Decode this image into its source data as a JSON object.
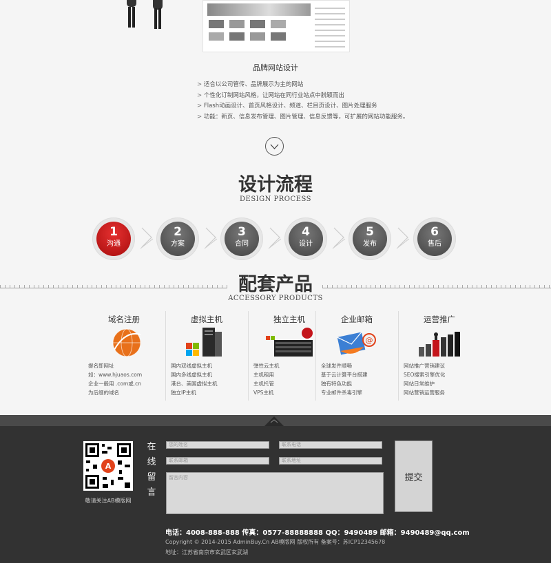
{
  "showcase": {
    "title": "品牌网站设计",
    "features": [
      "适合以公司管传、品牌展示为主的网站",
      "个性化订制网站风格，让网站在同行业站点中脱颖而出",
      "Flash动画设计、首页风格设计、频道、栏目页设计、图片处理服务",
      "功能：新页、信息发布管理、图片管理、信息反馈等，可扩展的网站功能服务。"
    ]
  },
  "process": {
    "title": "设计流程",
    "subtitle": "DESIGN PROCESS",
    "steps": [
      {
        "num": "1",
        "label": "沟通"
      },
      {
        "num": "2",
        "label": "方案"
      },
      {
        "num": "3",
        "label": "合同"
      },
      {
        "num": "4",
        "label": "设计"
      },
      {
        "num": "5",
        "label": "发布"
      },
      {
        "num": "6",
        "label": "售后"
      }
    ]
  },
  "products": {
    "title": "配套产品",
    "subtitle": "ACCESSORY PRODUCTS",
    "items": [
      {
        "title": "域名注册",
        "lines": [
          "提名即网址",
          "如：www.hjuaos.com",
          "企业一般用 .com或.cn",
          "为后缀的域名"
        ]
      },
      {
        "title": "虚拟主机",
        "lines": [
          "国内双线虚拟主机",
          "国内多线虚拟主机",
          "港台、美国虚拟主机",
          "独立IP主机"
        ]
      },
      {
        "title": "独立主机",
        "lines": [
          "弹性云主机",
          "主机租用",
          "主机托管",
          "VPS主机"
        ]
      },
      {
        "title": "企业邮箱",
        "lines": [
          "全球发件顺畅",
          "基于云计算平台搭建",
          "独有特色功能",
          "专业邮件杀毒引擎"
        ]
      },
      {
        "title": "运营推广",
        "lines": [
          "网站推广营销建议",
          "SEO搜索引擎优化",
          "网站日常维护",
          "网站营销运营服务"
        ]
      }
    ]
  },
  "footer": {
    "qr_caption": "敬请关注AB模版网",
    "message_title": "在线留言",
    "fields": [
      "您的姓名",
      "联系电话",
      "联系邮箱",
      "联系地址"
    ],
    "message_placeholder": "留言内容",
    "submit_label": "提交",
    "contact": "电话：4008-888-888   传真：0577-88888888   QQ：9490489   邮箱：9490489@qq.com",
    "copyright": "Copyright © 2014-2015 AdminBuy.Cn AB模版网 版权所有 备案号：苏ICP12345678",
    "address": "地址：江苏省南京市玄武区玄武湖"
  }
}
